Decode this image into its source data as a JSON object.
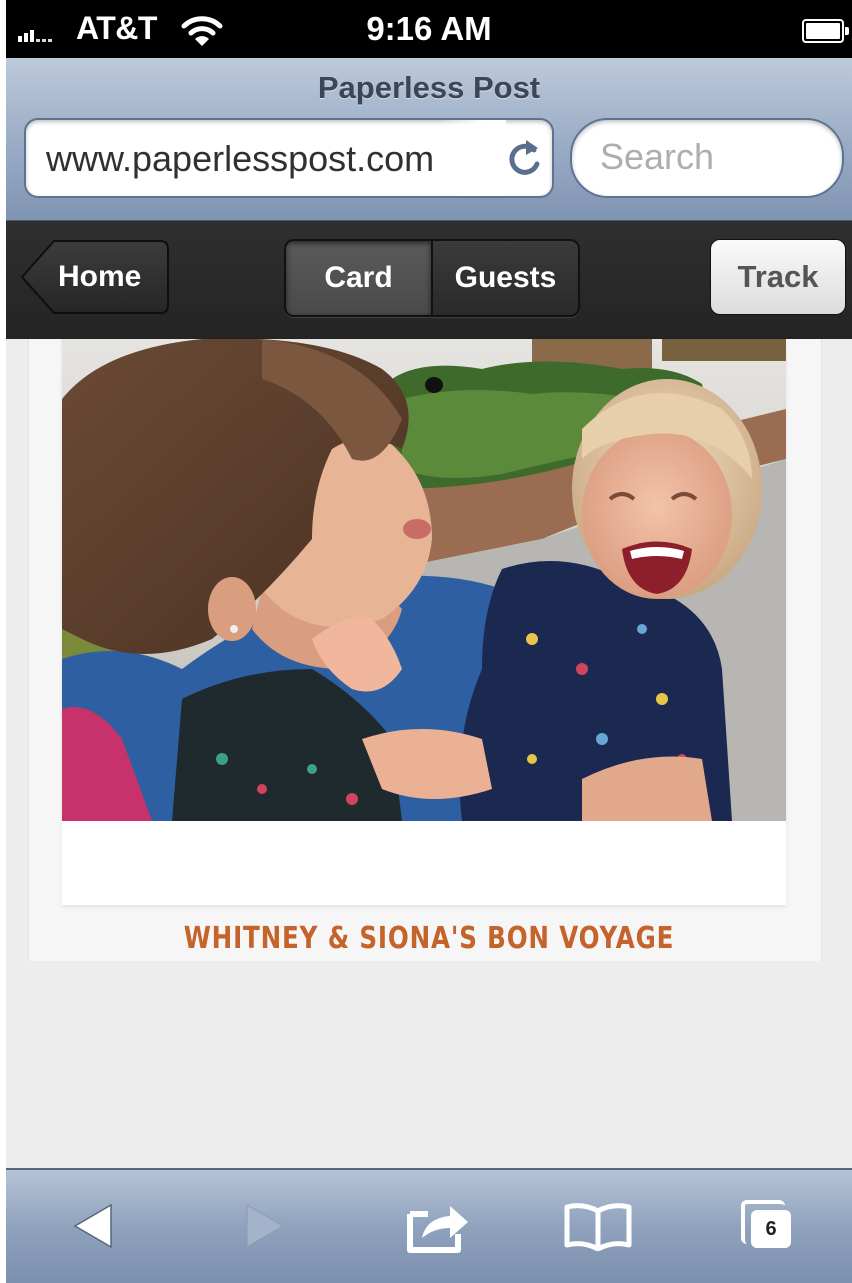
{
  "status_bar": {
    "carrier": "AT&T",
    "time": "9:16 AM"
  },
  "browser": {
    "page_title": "Paperless Post",
    "url": "www.paperlesspost.com",
    "search_placeholder": "Search",
    "tab_count": "6"
  },
  "app_nav": {
    "back_label": "Home",
    "segments": [
      {
        "label": "Card",
        "selected": true
      },
      {
        "label": "Guests",
        "selected": false
      }
    ],
    "track_label": "Track"
  },
  "card": {
    "caption": "WHITNEY & SIONA'S BON VOYAGE"
  },
  "colors": {
    "caption": "#c4632a",
    "toolbar": "#8fa2bd",
    "nav_bar": "#2a2a2a"
  },
  "icons": {
    "back": "triangle-left-icon",
    "forward": "triangle-right-icon",
    "share": "share-icon",
    "bookmarks": "open-book-icon",
    "tabs": "pages-icon",
    "reload": "reload-icon",
    "wifi": "wifi-icon",
    "battery": "battery-icon",
    "signal": "signal-icon"
  }
}
